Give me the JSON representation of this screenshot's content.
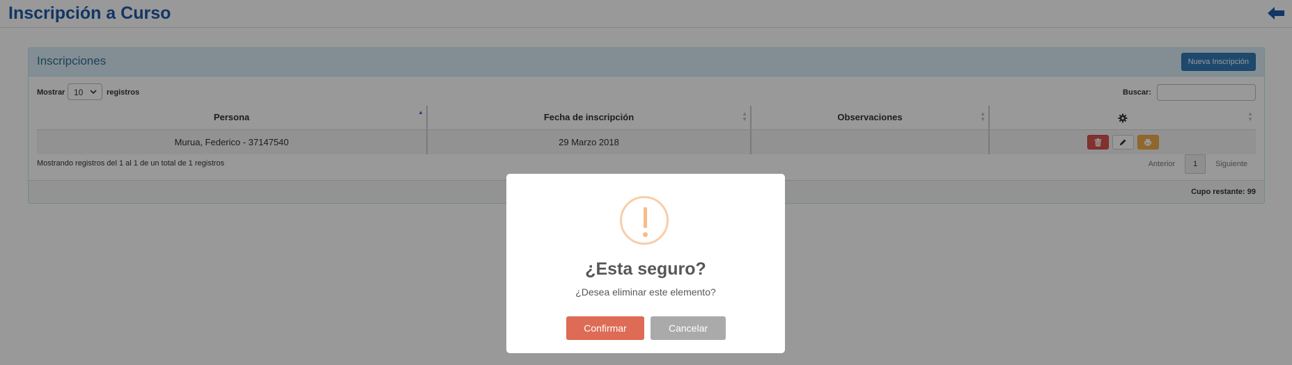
{
  "header": {
    "title": "Inscripción a Curso"
  },
  "panel": {
    "title": "Inscripciones",
    "new_button": "Nueva Inscripción",
    "show_label": "Mostrar",
    "page_length": "10",
    "records_label": "registros",
    "search_label": "Buscar:",
    "search_value": ""
  },
  "table": {
    "columns": [
      "Persona",
      "Fecha de inscripción",
      "Observaciones"
    ],
    "rows": [
      {
        "persona": "Murua, Federico - 37147540",
        "fecha": "29 Marzo 2018",
        "observaciones": ""
      }
    ]
  },
  "footer": {
    "info": "Mostrando registros del 1 al 1 de un total de 1 registros",
    "prev": "Anterior",
    "page": "1",
    "next": "Siguiente",
    "cupo": "Cupo restante: 99"
  },
  "modal": {
    "title": "¿Esta seguro?",
    "text": "¿Desea eliminar este elemento?",
    "confirm": "Confirmar",
    "cancel": "Cancelar"
  },
  "colors": {
    "title_blue": "#1f5ba8",
    "panel_heading": "#d9edf7",
    "primary": "#337ab7",
    "danger": "#d9534f",
    "warning": "#f0ad4e",
    "confirm": "#dd6b55",
    "cancel": "#aaaaaa",
    "overlay": "rgba(0,0,0,0.4)"
  }
}
